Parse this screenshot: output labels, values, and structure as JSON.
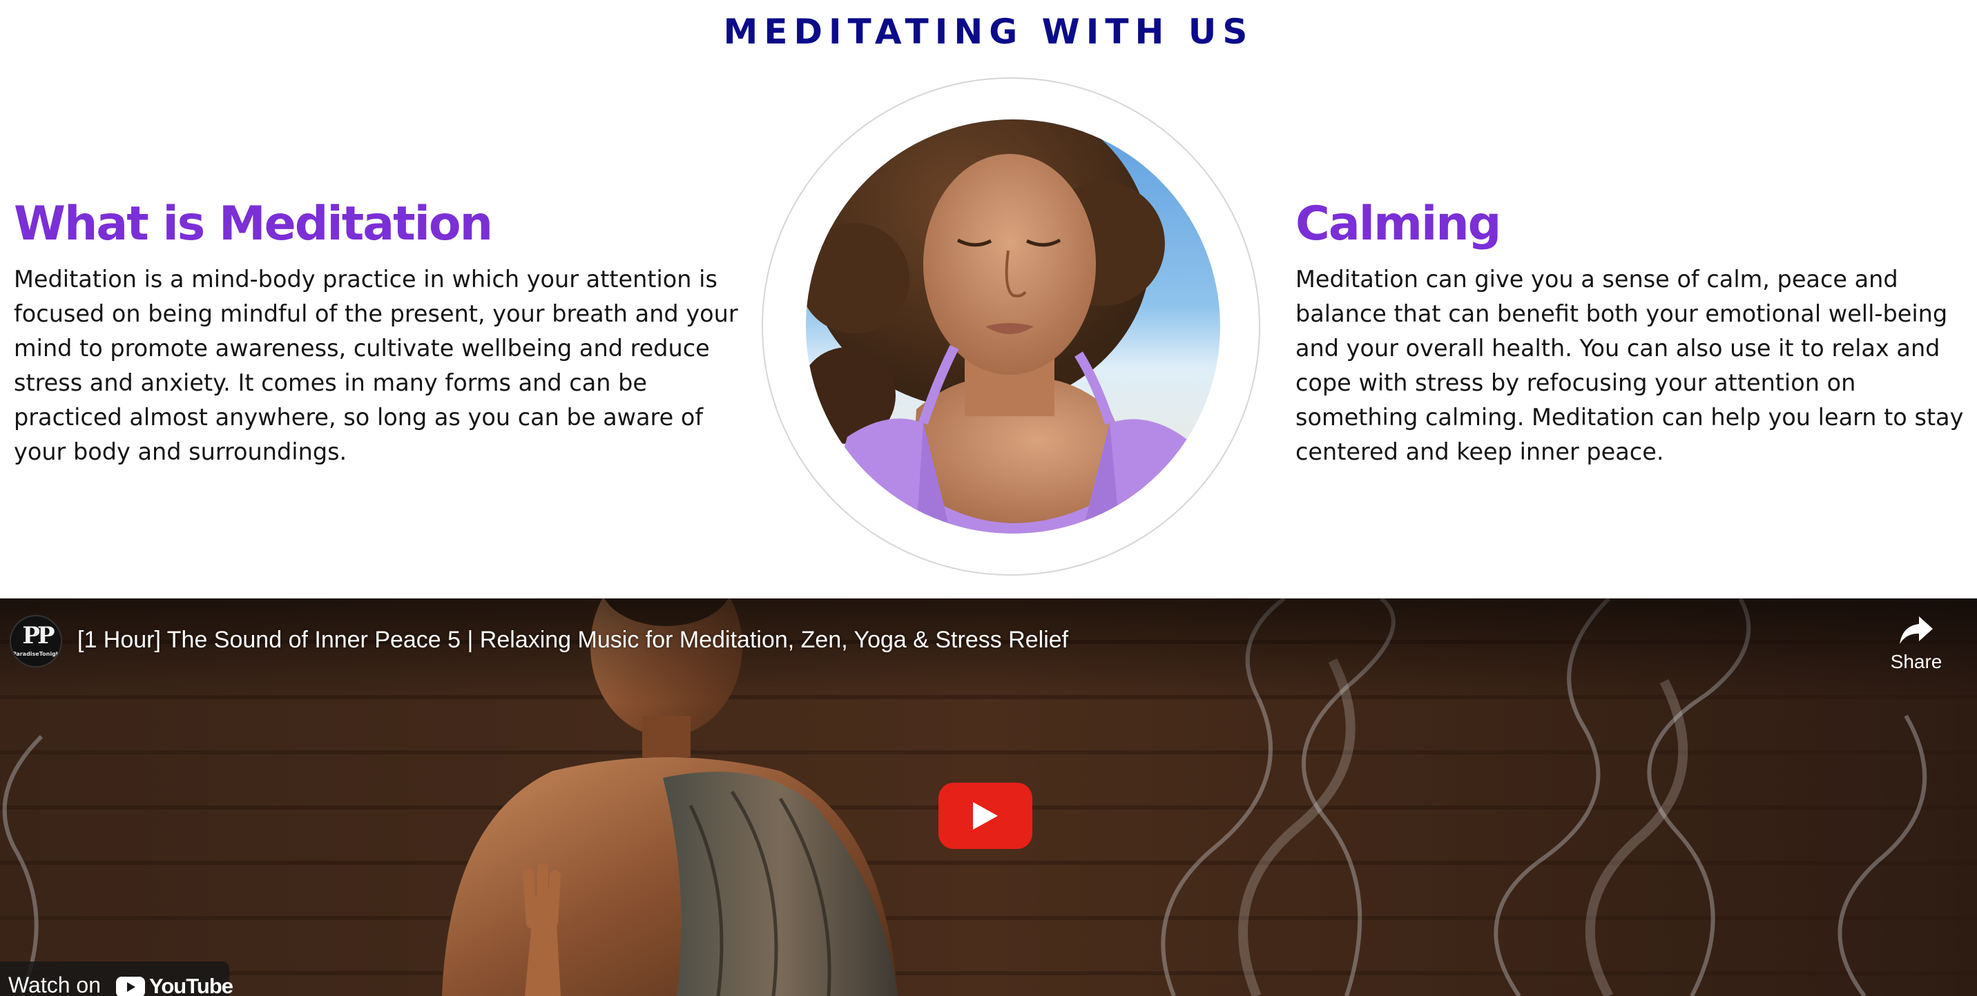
{
  "section": {
    "heading": "MEDITATING WITH US"
  },
  "left_column": {
    "title": "What is Meditation",
    "body": "Meditation is a mind-body practice in which your attention is focused on being mindful of the present, your breath and your mind to promote awareness, cultivate wellbeing and reduce stress and anxiety. It comes in many forms and can be practiced almost anywhere, so long as you can be aware of your body and surroundings."
  },
  "right_column": {
    "title": "Calming",
    "body": "Meditation can give you a sense of calm, peace and balance that can benefit both your emotional well-being and your overall health. You can also use it to relax and cope with stress by refocusing your attention on something calming. Meditation can help you learn to stay centered and keep inner peace."
  },
  "center_image": {
    "icon": "meditating-woman-photo"
  },
  "video": {
    "title": "[1 Hour] The Sound of Inner Peace 5 | Relaxing Music for Meditation, Zen, Yoga & Stress Relief",
    "channel_avatar_letters": "PP",
    "channel_avatar_text": "ParadiseTonight",
    "share_label": "Share",
    "watch_on_label": "Watch on",
    "youtube_label": "YouTube",
    "play_icon": "play-icon",
    "share_icon": "share-arrow-icon"
  },
  "colors": {
    "heading": "#0b0b8a",
    "column_title": "#7b2fd6",
    "body_text": "#141414",
    "play_button": "#e62117"
  }
}
